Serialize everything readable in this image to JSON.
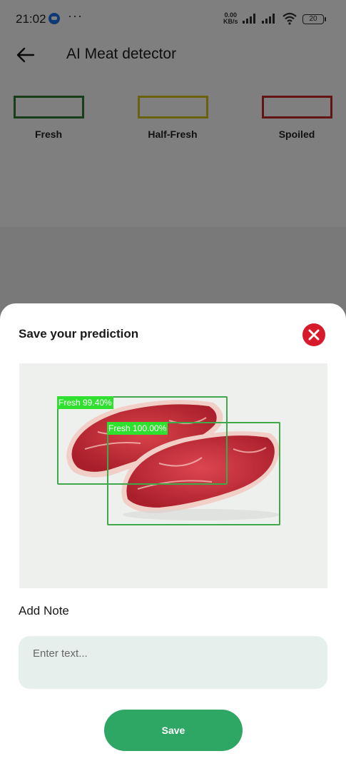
{
  "status_bar": {
    "time": "21:02",
    "net_speed": "0.00",
    "net_unit": "KB/s",
    "battery": "20"
  },
  "app_bar": {
    "title": "AI Meat detector"
  },
  "legend": [
    {
      "label": "Fresh",
      "color": "#2e7d32"
    },
    {
      "label": "Half-Fresh",
      "color": "#d4c21a"
    },
    {
      "label": "Spoiled",
      "color": "#c62828"
    }
  ],
  "sheet": {
    "title": "Save your prediction",
    "detections": [
      {
        "label": "Fresh 99.40%"
      },
      {
        "label": "Fresh 100.00%"
      }
    ],
    "note_label": "Add Note",
    "note_placeholder": "Enter text...",
    "save_label": "Save"
  },
  "colors": {
    "accent": "#2ea664",
    "close": "#d81b2c",
    "detection_box": "#3fa84a",
    "detection_label": "#2fe02f"
  }
}
